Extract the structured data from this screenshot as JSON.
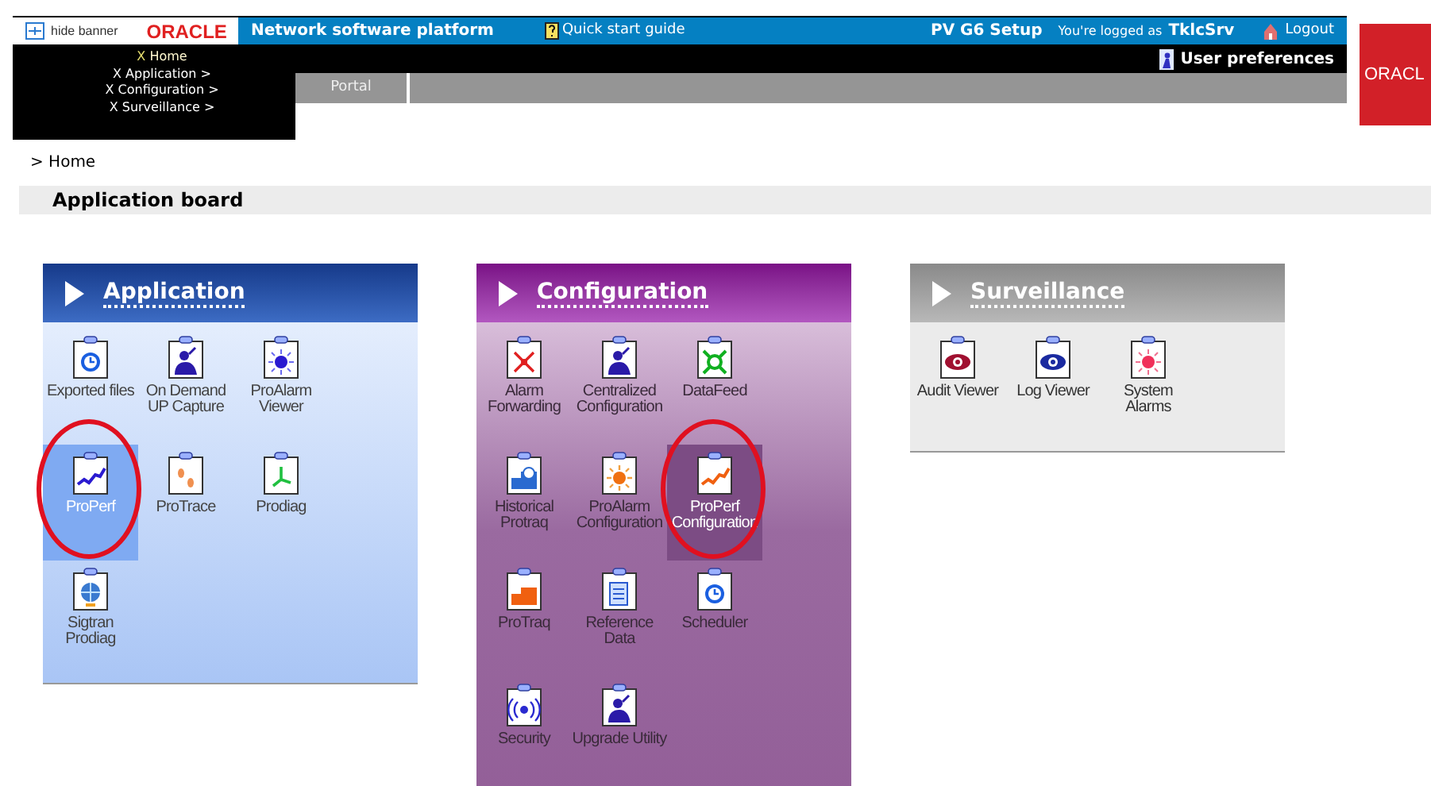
{
  "banner": {
    "hide_label": "hide banner",
    "logo": "ORACLE",
    "title": "Network software platform",
    "help": "Quick start guide",
    "setup": "PV G6 Setup",
    "logged_prefix": "You're logged as",
    "user": "TklcSrv",
    "logout": "Logout",
    "preferences": "User preferences",
    "side_logo": "ORACL"
  },
  "menu": [
    {
      "bullet": "X",
      "label": "Home",
      "selected": true
    },
    {
      "bullet": "X",
      "label": "Application >",
      "selected": false
    },
    {
      "bullet": "X",
      "label": "Configuration >",
      "selected": false
    },
    {
      "bullet": "X",
      "label": "Surveillance >",
      "selected": false
    }
  ],
  "tabs": [
    {
      "label": "Portal",
      "selected": false
    }
  ],
  "breadcrumb": "> Home",
  "board_title": "Application board",
  "panels": [
    {
      "title": "Application",
      "kind": "blue",
      "items": [
        {
          "label": "Exported files",
          "kind": "clock",
          "selected": false,
          "circled": false
        },
        {
          "label": "On Demand UP Capture",
          "kind": "person",
          "selected": false,
          "circled": false
        },
        {
          "label": "ProAlarm Viewer",
          "kind": "burst",
          "selected": false,
          "circled": false
        },
        {
          "label": "ProPerf",
          "kind": "chart",
          "selected": true,
          "circled": true
        },
        {
          "label": "ProTrace",
          "kind": "footprints",
          "selected": false,
          "circled": false
        },
        {
          "label": "Prodiag",
          "kind": "axes",
          "selected": false,
          "circled": false
        },
        {
          "label": "Sigtran Prodiag",
          "kind": "globe",
          "selected": false,
          "circled": false
        }
      ]
    },
    {
      "title": "Configuration",
      "kind": "purple",
      "items": [
        {
          "label": "Alarm Forwarding",
          "kind": "arrows",
          "selected": false,
          "circled": false
        },
        {
          "label": "Centralized Configuration",
          "kind": "person",
          "selected": false,
          "circled": false
        },
        {
          "label": "DataFeed",
          "kind": "network",
          "selected": false,
          "circled": false
        },
        {
          "label": "Historical Protraq",
          "kind": "history",
          "selected": false,
          "circled": false
        },
        {
          "label": "ProAlarm Configuration",
          "kind": "sun",
          "selected": false,
          "circled": false
        },
        {
          "label": "ProPerf Configuration",
          "kind": "orangechart",
          "selected": true,
          "circled": true
        },
        {
          "label": "ProTraq",
          "kind": "traq",
          "selected": false,
          "circled": false
        },
        {
          "label": "Reference Data",
          "kind": "document",
          "selected": false,
          "circled": false
        },
        {
          "label": "Scheduler",
          "kind": "clock",
          "selected": false,
          "circled": false
        },
        {
          "label": "Security",
          "kind": "signal",
          "selected": false,
          "circled": false
        },
        {
          "label": "Upgrade Utility",
          "kind": "person",
          "selected": false,
          "circled": false
        }
      ]
    },
    {
      "title": "Surveillance",
      "kind": "gray",
      "items": [
        {
          "label": "Audit Viewer",
          "kind": "redeye",
          "selected": false,
          "circled": false
        },
        {
          "label": "Log Viewer",
          "kind": "blueeye",
          "selected": false,
          "circled": false
        },
        {
          "label": "System Alarms",
          "kind": "redburst",
          "selected": false,
          "circled": false
        }
      ]
    }
  ]
}
